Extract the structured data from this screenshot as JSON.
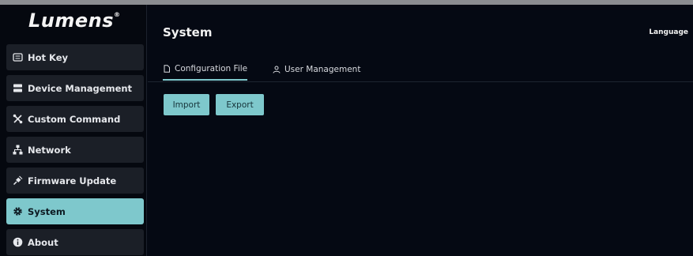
{
  "brand": {
    "logo_text": "Lumens",
    "logo_mark": "®"
  },
  "sidebar": {
    "items": [
      {
        "label": "Hot Key",
        "icon": "keyboard-icon"
      },
      {
        "label": "Device Management",
        "icon": "server-icon"
      },
      {
        "label": "Custom Command",
        "icon": "tools-icon"
      },
      {
        "label": "Network",
        "icon": "network-icon"
      },
      {
        "label": "Firmware Update",
        "icon": "plug-icon"
      },
      {
        "label": "System",
        "icon": "gear-icon",
        "active": true
      },
      {
        "label": "About",
        "icon": "info-icon"
      }
    ]
  },
  "header": {
    "title": "System",
    "language_label": "Language"
  },
  "tabs": [
    {
      "label": "Configuration File",
      "icon": "file-icon",
      "active": true
    },
    {
      "label": "User Management",
      "icon": "user-icon",
      "active": false
    }
  ],
  "actions": {
    "import_label": "Import",
    "export_label": "Export"
  },
  "colors": {
    "accent": "#7ec8cc",
    "background": "#050913",
    "nav_bg": "#1b1f27"
  }
}
